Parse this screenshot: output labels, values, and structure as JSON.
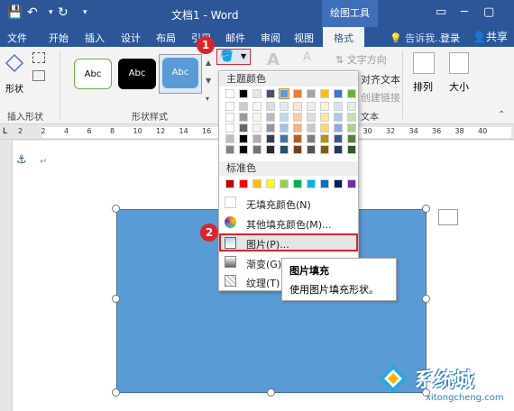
{
  "titlebar": {
    "title": "文档1 - Word",
    "context_tab": "绘图工具",
    "undo_icon": "↶",
    "redo_icon": "↻",
    "save_icon": "💾"
  },
  "tabs": {
    "items": [
      "文件",
      "开始",
      "插入",
      "设计",
      "布局",
      "引用",
      "邮件",
      "审阅",
      "视图"
    ],
    "active": "格式",
    "tell_me": "告诉我...",
    "login": "登录",
    "share": "共享"
  },
  "ribbon": {
    "insert_shapes_label": "插入形状",
    "shape_label": "形状",
    "shape_styles_label": "形状样式",
    "style_sample": "Abc",
    "text_direction": "文字方向",
    "align_text": "对齐文本",
    "create_link": "创建链接",
    "text_group": "文本",
    "arrange": "排列",
    "size": "大小"
  },
  "ruler": {
    "numbers": [
      "2",
      "2",
      "4",
      "6",
      "8",
      "10",
      "12",
      "14",
      "16",
      "18",
      "20",
      "22",
      "24",
      "26",
      "28",
      "30",
      "32",
      "34",
      "36",
      "38",
      "40"
    ]
  },
  "dropdown": {
    "theme_colors_label": "主题颜色",
    "standard_colors_label": "标准色",
    "no_fill": "无填充颜色(N)",
    "more_colors": "其他填充颜色(M)...",
    "picture": "图片(P)...",
    "gradient": "渐变(G)",
    "texture": "纹理(T)",
    "theme_row": [
      "#ffffff",
      "#000000",
      "#e7e6e6",
      "#44546a",
      "#5b9bd5",
      "#ed7d31",
      "#a5a5a5",
      "#ffc000",
      "#4472c4",
      "#70ad47"
    ],
    "standard_row": [
      "#c00000",
      "#ff0000",
      "#ffc000",
      "#ffff00",
      "#92d050",
      "#00b050",
      "#00b0f0",
      "#0070c0",
      "#002060",
      "#7030a0"
    ]
  },
  "tooltip": {
    "title": "图片填充",
    "desc": "使用图片填充形状。"
  },
  "badges": {
    "one": "1",
    "two": "2"
  },
  "watermark": {
    "brand": "系统城",
    "url": "xitongcheng.com"
  },
  "colors": {
    "accent": "#2b579a",
    "shape_fill": "#5b9bd5",
    "badge": "#d9262c"
  }
}
